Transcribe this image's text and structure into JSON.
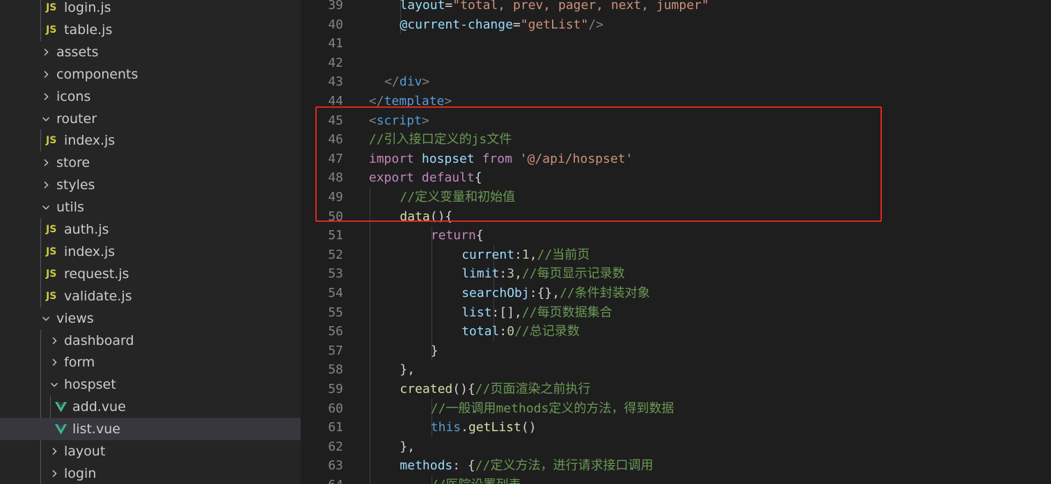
{
  "explorer": {
    "items": [
      {
        "label": "login.js",
        "type": "file",
        "icon": "js-icon",
        "depth": 2
      },
      {
        "label": "table.js",
        "type": "file",
        "icon": "js-icon",
        "depth": 2
      },
      {
        "label": "assets",
        "type": "folder",
        "expanded": false,
        "depth": 1
      },
      {
        "label": "components",
        "type": "folder",
        "expanded": false,
        "depth": 1
      },
      {
        "label": "icons",
        "type": "folder",
        "expanded": false,
        "depth": 1
      },
      {
        "label": "router",
        "type": "folder",
        "expanded": true,
        "depth": 1
      },
      {
        "label": "index.js",
        "type": "file",
        "icon": "js-icon",
        "depth": 2
      },
      {
        "label": "store",
        "type": "folder",
        "expanded": false,
        "depth": 1
      },
      {
        "label": "styles",
        "type": "folder",
        "expanded": false,
        "depth": 1
      },
      {
        "label": "utils",
        "type": "folder",
        "expanded": true,
        "depth": 1
      },
      {
        "label": "auth.js",
        "type": "file",
        "icon": "js-icon",
        "depth": 2
      },
      {
        "label": "index.js",
        "type": "file",
        "icon": "js-icon",
        "depth": 2
      },
      {
        "label": "request.js",
        "type": "file",
        "icon": "js-icon",
        "depth": 2
      },
      {
        "label": "validate.js",
        "type": "file",
        "icon": "js-icon",
        "depth": 2
      },
      {
        "label": "views",
        "type": "folder",
        "expanded": true,
        "depth": 1
      },
      {
        "label": "dashboard",
        "type": "folder",
        "expanded": false,
        "depth": 2
      },
      {
        "label": "form",
        "type": "folder",
        "expanded": false,
        "depth": 2
      },
      {
        "label": "hospset",
        "type": "folder",
        "expanded": true,
        "depth": 2
      },
      {
        "label": "add.vue",
        "type": "file",
        "icon": "vue-icon",
        "depth": 3
      },
      {
        "label": "list.vue",
        "type": "file",
        "icon": "vue-icon",
        "depth": 3,
        "selected": true
      },
      {
        "label": "layout",
        "type": "folder",
        "expanded": false,
        "depth": 2
      },
      {
        "label": "login",
        "type": "folder",
        "expanded": false,
        "depth": 2
      }
    ],
    "js_icon_text": "JS"
  },
  "editor": {
    "lines": [
      {
        "n": "39",
        "indent": 8,
        "tokens": [
          [
            "layout",
            "#9cdcfe"
          ],
          [
            "=",
            "#d4d4d4"
          ],
          [
            "\"total, prev, pager, next, jumper\"",
            "#ce9178"
          ]
        ]
      },
      {
        "n": "40",
        "indent": 8,
        "tokens": [
          [
            "@current-change",
            "#9cdcfe"
          ],
          [
            "=",
            "#d4d4d4"
          ],
          [
            "\"getList\"",
            "#ce9178"
          ],
          [
            "/>",
            "#808080"
          ]
        ]
      },
      {
        "n": "41",
        "indent": 0,
        "tokens": []
      },
      {
        "n": "42",
        "indent": 0,
        "tokens": []
      },
      {
        "n": "43",
        "indent": 4,
        "tokens": [
          [
            "</",
            "#808080"
          ],
          [
            "div",
            "#569cd6"
          ],
          [
            ">",
            "#808080"
          ]
        ]
      },
      {
        "n": "44",
        "indent": 0,
        "tokens": [
          [
            "</",
            "#808080"
          ],
          [
            "template",
            "#569cd6"
          ],
          [
            ">",
            "#808080"
          ]
        ]
      },
      {
        "n": "45",
        "indent": 0,
        "tokens": [
          [
            "<",
            "#808080"
          ],
          [
            "script",
            "#569cd6"
          ],
          [
            ">",
            "#808080"
          ]
        ]
      },
      {
        "n": "46",
        "indent": 0,
        "tokens": [
          [
            "//引入接口定义的js文件",
            "#6a9955"
          ]
        ]
      },
      {
        "n": "47",
        "indent": 0,
        "tokens": [
          [
            "import",
            "#c586c0"
          ],
          [
            " ",
            "#d4d4d4"
          ],
          [
            "hospset",
            "#9cdcfe"
          ],
          [
            " ",
            "#d4d4d4"
          ],
          [
            "from",
            "#c586c0"
          ],
          [
            " ",
            "#d4d4d4"
          ],
          [
            "'@/api/hospset'",
            "#ce9178"
          ]
        ]
      },
      {
        "n": "48",
        "indent": 0,
        "tokens": [
          [
            "export",
            "#c586c0"
          ],
          [
            " ",
            "#d4d4d4"
          ],
          [
            "default",
            "#c586c0"
          ],
          [
            "{",
            "#d4d4d4"
          ]
        ]
      },
      {
        "n": "49",
        "indent": 8,
        "tokens": [
          [
            "//定义变量和初始值",
            "#6a9955"
          ]
        ]
      },
      {
        "n": "50",
        "indent": 8,
        "tokens": [
          [
            "data",
            "#dcdcaa"
          ],
          [
            "(){",
            "#d4d4d4"
          ]
        ]
      },
      {
        "n": "51",
        "indent": 16,
        "tokens": [
          [
            "return",
            "#c586c0"
          ],
          [
            "{",
            "#d4d4d4"
          ]
        ]
      },
      {
        "n": "52",
        "indent": 24,
        "tokens": [
          [
            "current",
            "#9cdcfe"
          ],
          [
            ":",
            "#d4d4d4"
          ],
          [
            "1",
            "#b5cea8"
          ],
          [
            ",",
            "#d4d4d4"
          ],
          [
            "//当前页",
            "#6a9955"
          ]
        ]
      },
      {
        "n": "53",
        "indent": 24,
        "tokens": [
          [
            "limit",
            "#9cdcfe"
          ],
          [
            ":",
            "#d4d4d4"
          ],
          [
            "3",
            "#b5cea8"
          ],
          [
            ",",
            "#d4d4d4"
          ],
          [
            "//每页显示记录数",
            "#6a9955"
          ]
        ]
      },
      {
        "n": "54",
        "indent": 24,
        "tokens": [
          [
            "searchObj",
            "#9cdcfe"
          ],
          [
            ":{},",
            "#d4d4d4"
          ],
          [
            "//条件封装对象",
            "#6a9955"
          ]
        ]
      },
      {
        "n": "55",
        "indent": 24,
        "tokens": [
          [
            "list",
            "#9cdcfe"
          ],
          [
            ":[],",
            "#d4d4d4"
          ],
          [
            "//每页数据集合",
            "#6a9955"
          ]
        ]
      },
      {
        "n": "56",
        "indent": 24,
        "tokens": [
          [
            "total",
            "#9cdcfe"
          ],
          [
            ":",
            "#d4d4d4"
          ],
          [
            "0",
            "#b5cea8"
          ],
          [
            "//总记录数",
            "#6a9955"
          ]
        ]
      },
      {
        "n": "57",
        "indent": 16,
        "tokens": [
          [
            "}",
            "#d4d4d4"
          ]
        ]
      },
      {
        "n": "58",
        "indent": 8,
        "tokens": [
          [
            "},",
            "#d4d4d4"
          ]
        ]
      },
      {
        "n": "59",
        "indent": 8,
        "tokens": [
          [
            "created",
            "#dcdcaa"
          ],
          [
            "(){",
            "#d4d4d4"
          ],
          [
            "//页面渲染之前执行",
            "#6a9955"
          ]
        ]
      },
      {
        "n": "60",
        "indent": 16,
        "tokens": [
          [
            "//一般调用methods定义的方法，得到数据",
            "#6a9955"
          ]
        ]
      },
      {
        "n": "61",
        "indent": 16,
        "tokens": [
          [
            "this",
            "#569cd6"
          ],
          [
            ".",
            "#d4d4d4"
          ],
          [
            "getList",
            "#dcdcaa"
          ],
          [
            "()",
            "#d4d4d4"
          ]
        ]
      },
      {
        "n": "62",
        "indent": 8,
        "tokens": [
          [
            "},",
            "#d4d4d4"
          ]
        ]
      },
      {
        "n": "63",
        "indent": 8,
        "tokens": [
          [
            "methods",
            "#9cdcfe"
          ],
          [
            ": {",
            "#d4d4d4"
          ],
          [
            "//定义方法，进行请求接口调用",
            "#6a9955"
          ]
        ]
      },
      {
        "n": "64",
        "indent": 16,
        "tokens": [
          [
            "//医院设置列表",
            "#6a9955"
          ]
        ]
      }
    ]
  },
  "colors": {
    "sidebar_bg": "#252526",
    "editor_bg": "#1e1e1e",
    "selected_row": "#37373d",
    "highlight_box": "#e0281c",
    "js_icon": "#cbcb41",
    "vue_icon": "#41b883"
  }
}
